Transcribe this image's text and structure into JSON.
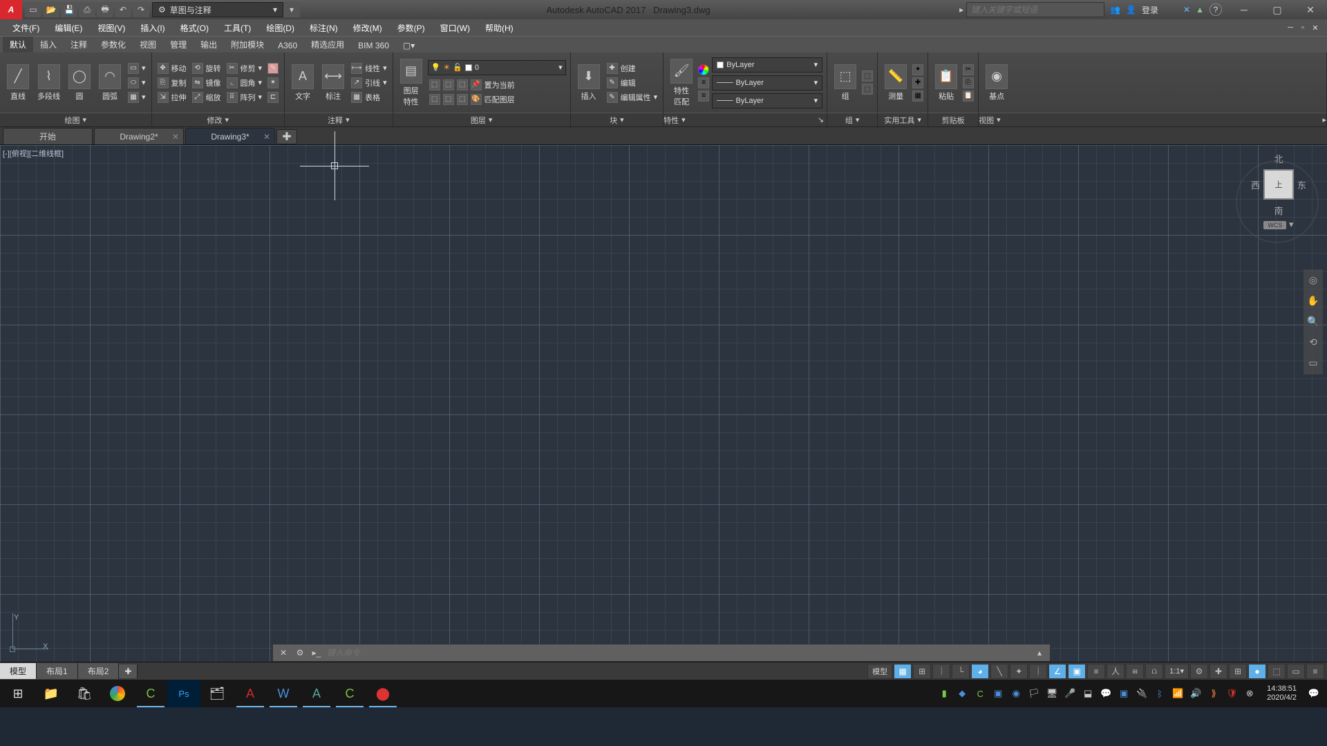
{
  "title": {
    "app": "Autodesk AutoCAD 2017",
    "doc": "Drawing3.dwg",
    "workspace": "草图与注释",
    "search_ph": "键入关键字或短语",
    "login": "登录"
  },
  "menu": [
    "文件(F)",
    "编辑(E)",
    "视图(V)",
    "插入(I)",
    "格式(O)",
    "工具(T)",
    "绘图(D)",
    "标注(N)",
    "修改(M)",
    "参数(P)",
    "窗口(W)",
    "帮助(H)"
  ],
  "ribbonTabs": [
    "默认",
    "插入",
    "注释",
    "参数化",
    "视图",
    "管理",
    "输出",
    "附加模块",
    "A360",
    "精选应用",
    "BIM 360"
  ],
  "panels": {
    "draw": {
      "title": "绘图",
      "line": "直线",
      "pline": "多段线",
      "circle": "圆",
      "arc": "圆弧"
    },
    "modify": {
      "title": "修改",
      "move": "移动",
      "rotate": "旋转",
      "trim": "修剪",
      "copy": "复制",
      "mirror": "镜像",
      "fillet": "圆角",
      "stretch": "拉伸",
      "scale": "缩放",
      "array": "阵列"
    },
    "annot": {
      "title": "注释",
      "text": "文字",
      "dim": "标注",
      "linear": "线性",
      "leader": "引线",
      "table": "表格"
    },
    "layer": {
      "title": "图层",
      "btn": "图层\n特性",
      "current": "0",
      "setcur": "置为当前",
      "match": "匹配图层"
    },
    "block": {
      "title": "块",
      "insert": "插入",
      "create": "创建",
      "edit": "编辑",
      "editattr": "编辑属性"
    },
    "props": {
      "title": "特性",
      "btn": "特性\n匹配",
      "bylayer": "ByLayer"
    },
    "group": {
      "title": "组",
      "btn": "组"
    },
    "utils": {
      "title": "实用工具",
      "measure": "测量"
    },
    "clip": {
      "title": "剪贴板",
      "paste": "粘贴"
    },
    "view": {
      "title": "视图",
      "base": "基点"
    }
  },
  "docTabs": {
    "start": "开始",
    "d2": "Drawing2*",
    "d3": "Drawing3*"
  },
  "viewport": {
    "label": "[-][俯视][二维线框]",
    "cube_top": "北",
    "cube_b": "南",
    "cube_l": "西",
    "cube_r": "东",
    "cube_face": "上",
    "wcs": "WCS"
  },
  "cmd": {
    "placeholder": "键入命令"
  },
  "layouts": {
    "model": "模型",
    "l1": "布局1",
    "l2": "布局2"
  },
  "status": {
    "model": "模型",
    "scale": "1:1"
  },
  "clock": {
    "time": "14:38:51",
    "date": "2020/4/2"
  }
}
